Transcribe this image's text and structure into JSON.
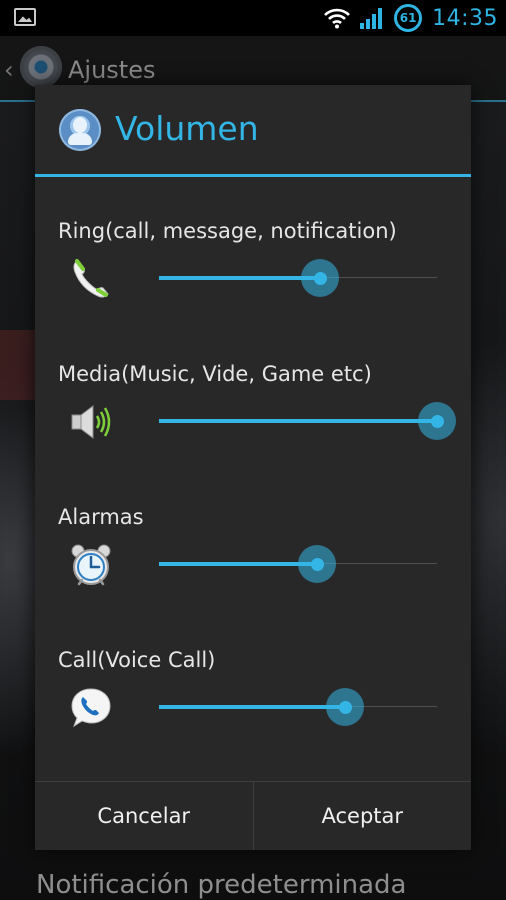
{
  "status_bar": {
    "battery_level": "61",
    "time": "14:35",
    "accent_color": "#33b5e5"
  },
  "background_app": {
    "title": "Ajustes",
    "bottom_item": "Notificación predeterminada"
  },
  "dialog": {
    "title": "Volumen",
    "sections": [
      {
        "label": "Ring(call, message, notification)",
        "icon": "phone-icon",
        "level": 0.58
      },
      {
        "label": "Media(Music, Vide, Game etc)",
        "icon": "speaker-icon",
        "level": 1.0
      },
      {
        "label": "Alarmas",
        "icon": "alarm-clock-icon",
        "level": 0.57
      },
      {
        "label": "Call(Voice Call)",
        "icon": "voice-call-icon",
        "level": 0.67
      }
    ],
    "buttons": {
      "cancel": "Cancelar",
      "accept": "Aceptar"
    }
  }
}
